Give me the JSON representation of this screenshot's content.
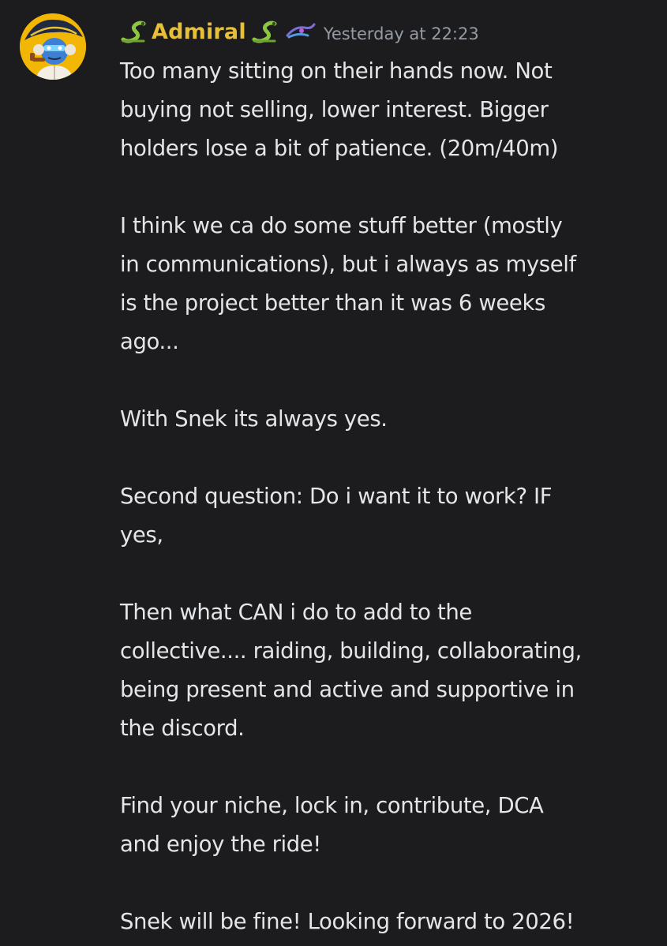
{
  "message": {
    "author": {
      "name": "Admiral",
      "name_color": "#e8c037",
      "avatar_icon": "admiral-avatar",
      "prefix_icon": "snake-icon",
      "suffix_icon": "snake-icon",
      "role_icon": "role-badge-icon"
    },
    "timestamp": "Yesterday at 22:23",
    "paragraphs": [
      "Too many sitting on their hands now. Not\nbuying not selling, lower interest. Bigger\nholders lose a bit of patience. (20m/40m)",
      "I think we ca do some stuff better (mostly\nin communications), but i always as myself\nis the project better than it was 6 weeks\nago...",
      "With Snek its always yes.",
      "Second question: Do i want it to work? IF\nyes,",
      "Then what CAN i do to add to the\ncollective.... raiding, building, collaborating,\nbeing present and active and supportive in\nthe discord.",
      "Find your niche, lock in, contribute, DCA\nand enjoy the ride!",
      "Snek will be fine! Looking forward to 2026!"
    ]
  },
  "colors": {
    "background": "#1c1c1f",
    "text": "#e3e5e8",
    "timestamp": "#949ba4",
    "username": "#e8c037",
    "snake_green": "#8cc63f"
  }
}
